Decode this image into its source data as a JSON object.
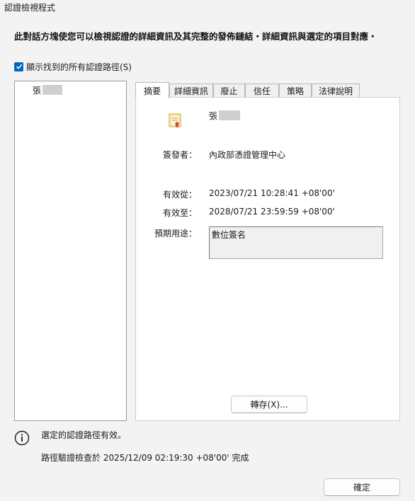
{
  "window": {
    "title": "認證檢視程式"
  },
  "intro": "此對話方塊使您可以檢視認證的詳細資訊及其完整的發佈鏈結・詳細資訊與選定的項目對應・",
  "show_all": {
    "label": "顯示找到的所有認證路徑(S)",
    "checked": true
  },
  "tree": {
    "items": [
      {
        "label": "張"
      }
    ]
  },
  "tabs": [
    {
      "label": "摘要",
      "active": true
    },
    {
      "label": "詳細資訊",
      "active": false
    },
    {
      "label": "廢止",
      "active": false
    },
    {
      "label": "信任",
      "active": false
    },
    {
      "label": "策略",
      "active": false
    },
    {
      "label": "法律說明",
      "active": false
    }
  ],
  "summary": {
    "subject": "張",
    "issuer_label": "簽發者：",
    "issuer": "內政部憑證管理中心",
    "valid_from_label": "有效從：",
    "valid_from": "2023/07/21 10:28:41 +08'00'",
    "valid_to_label": "有效至：",
    "valid_to": "2028/07/21 23:59:59 +08'00'",
    "purpose_label": "預期用途：",
    "purpose": "數位簽名",
    "export_label": "轉存(X)..."
  },
  "status": {
    "icon": "info-icon",
    "message": "選定的認證路徑有效。",
    "verified": "路徑驗證檢查於 2025/12/09 02:19:30 +08'00' 完成"
  },
  "ok_label": "確定",
  "colors": {
    "accent": "#0067c0",
    "background": "#f3f3f3"
  }
}
